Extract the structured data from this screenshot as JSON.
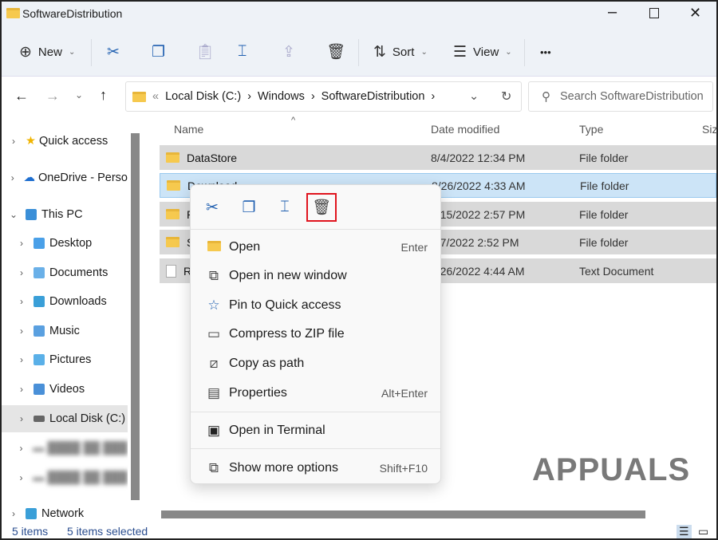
{
  "window": {
    "title": "SoftwareDistribution"
  },
  "toolbar": {
    "new": "New",
    "sort": "Sort",
    "view": "View",
    "more": "•••"
  },
  "address": {
    "crumbs": [
      "Local Disk (C:)",
      "Windows",
      "SoftwareDistribution"
    ],
    "overflow": "«"
  },
  "search": {
    "placeholder": "Search SoftwareDistribution"
  },
  "nav": {
    "items": [
      {
        "label": "Quick access"
      },
      {
        "label": "OneDrive - Perso"
      },
      {
        "label": "This PC"
      },
      {
        "label": "Desktop"
      },
      {
        "label": "Documents"
      },
      {
        "label": "Downloads"
      },
      {
        "label": "Music"
      },
      {
        "label": "Pictures"
      },
      {
        "label": "Videos"
      },
      {
        "label": "Local Disk (C:)"
      },
      {
        "label": "Network"
      }
    ]
  },
  "columns": {
    "name": "Name",
    "date": "Date modified",
    "type": "Type",
    "size": "Siz"
  },
  "files": [
    {
      "name": "DataStore",
      "date": "8/4/2022 12:34 PM",
      "type": "File folder"
    },
    {
      "name": "Download",
      "date": "8/26/2022 4:33 AM",
      "type": "File folder"
    },
    {
      "name": "Po",
      "date": "8/15/2022 2:57 PM",
      "type": "File folder"
    },
    {
      "name": "S",
      "date": "8/7/2022 2:52 PM",
      "type": "File folder"
    },
    {
      "name": "R",
      "date": "8/26/2022 4:44 AM",
      "type": "Text Document"
    }
  ],
  "context_menu": {
    "items": [
      {
        "label": "Open",
        "key": "Enter",
        "icon": "folder-open-icon"
      },
      {
        "label": "Open in new window",
        "key": "",
        "icon": "external-window-icon"
      },
      {
        "label": "Pin to Quick access",
        "key": "",
        "icon": "star-icon"
      },
      {
        "label": "Compress to ZIP file",
        "key": "",
        "icon": "zip-icon"
      },
      {
        "label": "Copy as path",
        "key": "",
        "icon": "copy-path-icon"
      },
      {
        "label": "Properties",
        "key": "Alt+Enter",
        "icon": "properties-icon"
      },
      {
        "label": "Open in Terminal",
        "key": "",
        "icon": "terminal-icon"
      },
      {
        "label": "Show more options",
        "key": "Shift+F10",
        "icon": "more-options-icon"
      }
    ]
  },
  "status": {
    "items": "5 items",
    "selected": "5 items selected"
  },
  "watermark": "APPUALS",
  "colors": {
    "accent": "#1f5fb0",
    "selection": "#cce4f7",
    "highlight_box": "#e0141e"
  }
}
